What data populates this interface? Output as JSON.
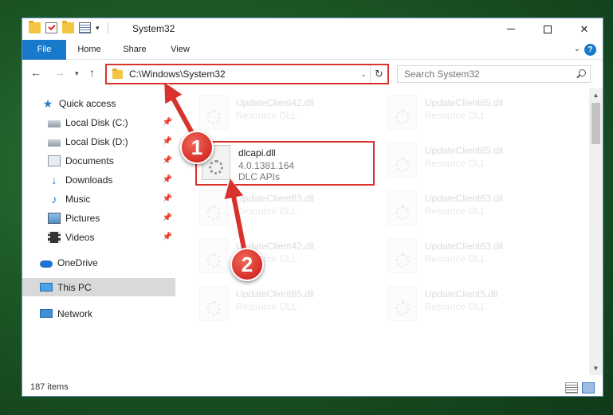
{
  "window": {
    "title": "System32",
    "icons": [
      "folder-icon",
      "properties-icon",
      "new-folder-icon",
      "customize-icon"
    ]
  },
  "ribbon": {
    "tabs": [
      {
        "label": "File",
        "active": true
      },
      {
        "label": "Home"
      },
      {
        "label": "Share"
      },
      {
        "label": "View"
      }
    ],
    "help_label": "?"
  },
  "nav": {
    "address": "C:\\Windows\\System32",
    "search_placeholder": "Search System32"
  },
  "sidebar": {
    "items": [
      {
        "label": "Quick access",
        "icon": "star-icon"
      },
      {
        "label": "Local Disk (C:)",
        "icon": "disk-icon",
        "pinned": true
      },
      {
        "label": "Local Disk (D:)",
        "icon": "disk-icon",
        "pinned": true
      },
      {
        "label": "Documents",
        "icon": "documents-icon",
        "pinned": true
      },
      {
        "label": "Downloads",
        "icon": "downloads-icon",
        "pinned": true
      },
      {
        "label": "Music",
        "icon": "music-icon",
        "pinned": true
      },
      {
        "label": "Pictures",
        "icon": "pictures-icon",
        "pinned": true
      },
      {
        "label": "Videos",
        "icon": "videos-icon",
        "pinned": true
      },
      {
        "label": "OneDrive",
        "icon": "onedrive-icon"
      },
      {
        "label": "This PC",
        "icon": "this-pc-icon",
        "selected": true
      },
      {
        "label": "Network",
        "icon": "network-icon"
      }
    ]
  },
  "files": [
    {
      "name": "UpdateClient42.dll",
      "desc": "Resource DLL"
    },
    {
      "name": "UpdateClient65.dll",
      "desc": "Resource DLL"
    },
    {
      "name": "dlcapi.dll",
      "version": "4.0.1381.164",
      "desc": "DLC APIs"
    },
    {
      "name": "UpdateClient65.dll",
      "desc": "Resource DLL"
    },
    {
      "name": "UpdateClient63.dll",
      "desc": "Resource DLL"
    },
    {
      "name": "UpdateClient63.dll",
      "desc": "Resource DLL"
    },
    {
      "name": "UpdateClient42.dll",
      "desc": "Resource DLL"
    },
    {
      "name": "UpdateClient63.dll",
      "desc": "Resource DLL"
    },
    {
      "name": "UpdateClient65.dll",
      "desc": "Resource DLL"
    },
    {
      "name": "UpdateClient5.dll",
      "desc": "Resource DLL"
    }
  ],
  "status": {
    "item_count": "187 items"
  },
  "annotations": {
    "badge_1": "1",
    "badge_2": "2",
    "accent_color": "#d9312b"
  }
}
